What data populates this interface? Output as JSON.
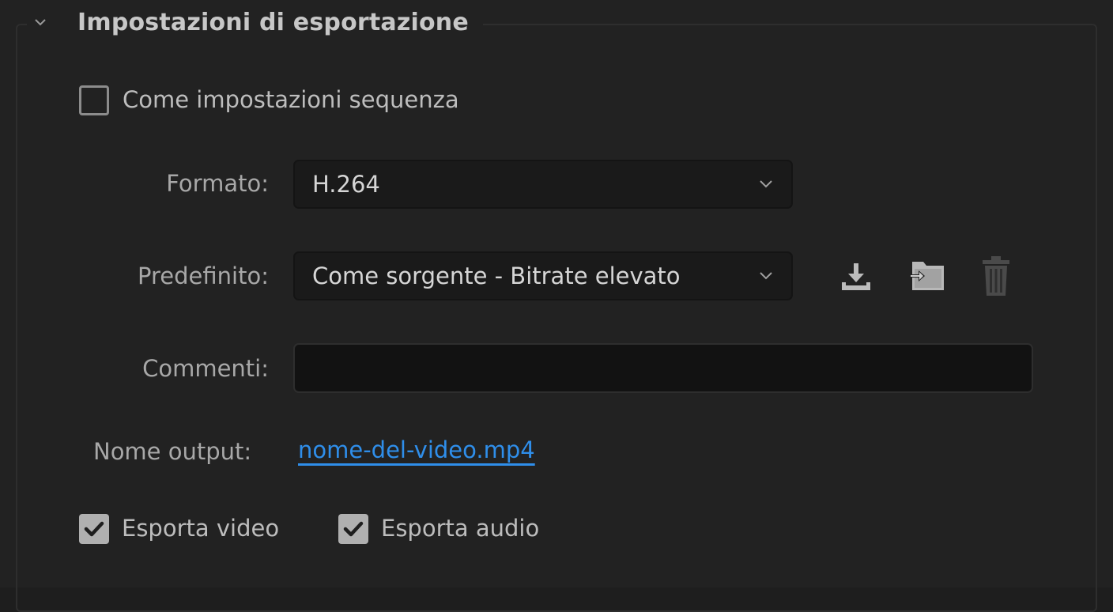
{
  "section": {
    "title": "Impostazioni di esportazione",
    "collapse_icon": "chevron-down-icon"
  },
  "match_sequence": {
    "label": "Come impostazioni sequenza",
    "checked": false
  },
  "format": {
    "label": "Formato:",
    "value": "H.264"
  },
  "preset": {
    "label": "Predefinito:",
    "value": "Come sorgente - Bitrate elevato",
    "actions": [
      {
        "name": "save-preset-button",
        "icon": "download-icon"
      },
      {
        "name": "import-preset-button",
        "icon": "import-folder-icon"
      },
      {
        "name": "delete-preset-button",
        "icon": "trash-icon",
        "enabled": false
      }
    ]
  },
  "comments": {
    "label": "Commenti:",
    "value": ""
  },
  "output": {
    "label": "Nome output:",
    "filename": "nome-del-video.mp4"
  },
  "export_video": {
    "label": "Esporta video",
    "checked": true
  },
  "export_audio": {
    "label": "Esporta audio",
    "checked": true
  },
  "colors": {
    "link": "#2f8eea",
    "panel_bg": "#222222",
    "field_bg": "#1a1a1a"
  }
}
